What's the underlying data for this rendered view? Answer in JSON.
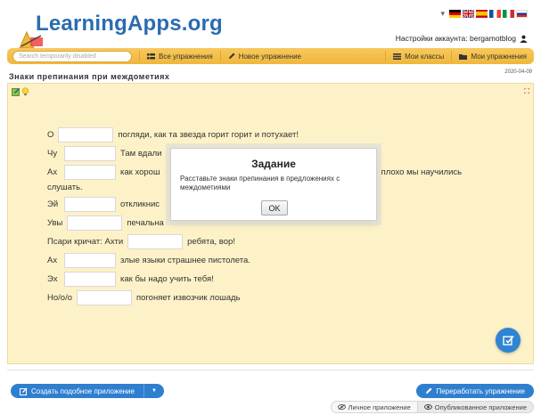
{
  "header": {
    "logo": "LearningApps.org",
    "account_label": "Настройки аккаунта: bergamotblog",
    "flags": [
      "de",
      "gb",
      "es",
      "fr",
      "it",
      "ru"
    ]
  },
  "menu": {
    "search_placeholder": "Search temporarily disabled",
    "all_exercises": "Все упражнения",
    "new_exercise": "Новое упражнение",
    "my_classes": "Мои классы",
    "my_apps": "Мои упражнения"
  },
  "page": {
    "title": "Знаки препинания при междометиях",
    "date": "2020-04-09"
  },
  "exercise": {
    "lines": [
      {
        "before": "О",
        "after": "погляди, как та звезда горит горит и потухает!"
      },
      {
        "before": "Чу",
        "after": "Там вдали"
      },
      {
        "before": "Ах",
        "after": "как хорош",
        "tail": "плохо мы научились"
      },
      {
        "text": "слушать."
      },
      {
        "before": "Эй",
        "after": "откликнис"
      },
      {
        "before": "Увы",
        "after": "печальна"
      },
      {
        "before": "Псари кричат: Ахти",
        "after": "ребята, вор!"
      },
      {
        "before": "Ах",
        "after": "злые языки страшнее пистолета."
      },
      {
        "before": "Эх",
        "after": "как бы надо учить тебя!"
      },
      {
        "before": "Но/о/о",
        "after": "погоняет извозчик лошадь"
      }
    ]
  },
  "dialog": {
    "title": "Задание",
    "text": "Расставьте знаки препинания в предложениях с междометиями",
    "ok": "OK"
  },
  "footer": {
    "create_similar": "Создать подобное приложение",
    "rework": "Переработать упражнение",
    "private_app": "Личное приложение",
    "published_app": "Опубликованное приложение"
  },
  "colors": {
    "accent_blue": "#2f7fd0",
    "menubar": "#f0b73a",
    "exercise_bg": "#fdf2c7"
  }
}
